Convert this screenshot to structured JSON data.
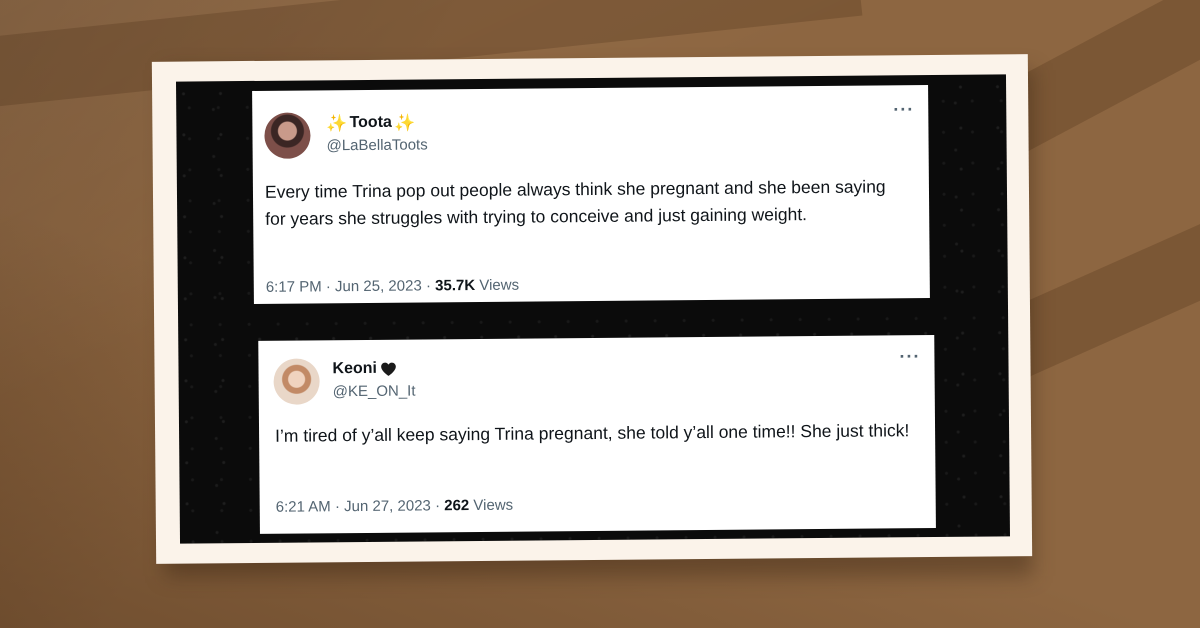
{
  "tweets": [
    {
      "display_name": "Toota",
      "name_emoji_left": "✨",
      "name_emoji_right": "✨",
      "handle": "@LaBellaToots",
      "text": "Every time Trina pop out people always think she pregnant and she been saying for years she struggles with trying to conceive and just gaining weight.",
      "time": "6:17 PM",
      "date": "Jun 25, 2023",
      "views_count": "35.7K",
      "views_label": "Views",
      "more_label": "···"
    },
    {
      "display_name": "Keoni",
      "handle": "@KE_ON_It",
      "text": "I’m tired of y’all keep saying Trina pregnant, she told y’all one time!! She just thick!",
      "time": "6:21 AM",
      "date": "Jun 27, 2023",
      "views_count": "262",
      "views_label": "Views",
      "more_label": "···"
    }
  ],
  "separator": "·",
  "colors": {
    "background": "#8d6641",
    "photo_border": "#fbf3ea",
    "photo_backdrop": "#0b0b0b",
    "text_primary": "#0f1419",
    "text_secondary": "#536471",
    "sparkle": "#f5b82e"
  },
  "icons": {
    "name_emoji_2": "black-heart-icon",
    "more": "more-options-icon"
  }
}
